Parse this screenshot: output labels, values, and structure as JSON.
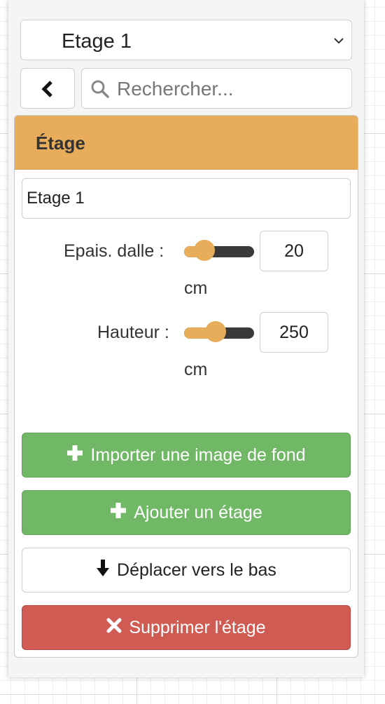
{
  "floor_select": {
    "value": "Etage 1",
    "icon": "chevron-down-icon"
  },
  "back_button": {
    "icon": "chevron-left-icon"
  },
  "search": {
    "placeholder": "Rechercher...",
    "icon": "search-icon"
  },
  "panel": {
    "header": "Étage",
    "name_value": "Etage 1",
    "slab_thickness": {
      "label": "Epais. dalle :",
      "value": "20",
      "unit": "cm",
      "slider_fraction": 0.29
    },
    "height": {
      "label": "Hauteur :",
      "value": "250",
      "unit": "cm",
      "slider_fraction": 0.45
    }
  },
  "buttons": {
    "import_bg": "Importer une image de fond",
    "add_floor": "Ajouter un étage",
    "move_down": "Déplacer vers le bas",
    "delete_floor": "Supprimer l'étage"
  },
  "colors": {
    "accent": "#e8ad5a",
    "success": "#71b866",
    "danger": "#cf5b53"
  }
}
